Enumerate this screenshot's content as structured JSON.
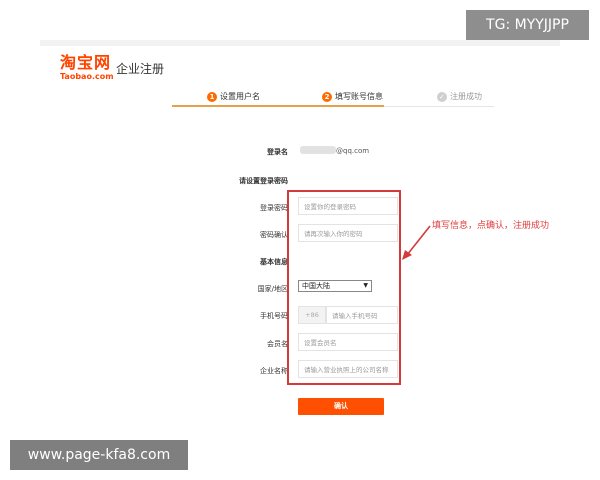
{
  "header": {
    "logo_text": "淘宝网",
    "logo_sub": "Taobao.com",
    "title": "企业注册"
  },
  "steps": [
    {
      "number": "1",
      "label": "设置用户名"
    },
    {
      "number": "2",
      "label": "填写账号信息"
    },
    {
      "number": "✓",
      "label": "注册成功"
    }
  ],
  "form": {
    "login_name_label": "登录名",
    "login_name_value": "@qq.com",
    "password_section": "请设置登录密码",
    "login_password_label": "登录密码",
    "login_password_placeholder": "设置你的登录密码",
    "password_confirm_label": "密码确认",
    "password_confirm_placeholder": "请再次输入你的密码",
    "basic_info_section": "基本信息",
    "country_label": "国家/地区",
    "country_value": "中国大陆",
    "phone_label": "手机号码",
    "phone_prefix": "+86",
    "phone_placeholder": "请输入手机号码",
    "member_label": "会员名",
    "member_placeholder": "设置会员名",
    "company_label": "企业名称",
    "company_placeholder": "请输入营业执照上的公司名称",
    "confirm_label": "确认"
  },
  "annotation": "填写信息，点确认，注册成功",
  "watermarks": {
    "tg": "TG: MYYJJPP",
    "site": "www.page-kfa8.com"
  },
  "colors": {
    "brand": "#ff4400",
    "step_active": "#ff6a00",
    "annotation": "#d33a3a",
    "button": "#ff4f00"
  }
}
